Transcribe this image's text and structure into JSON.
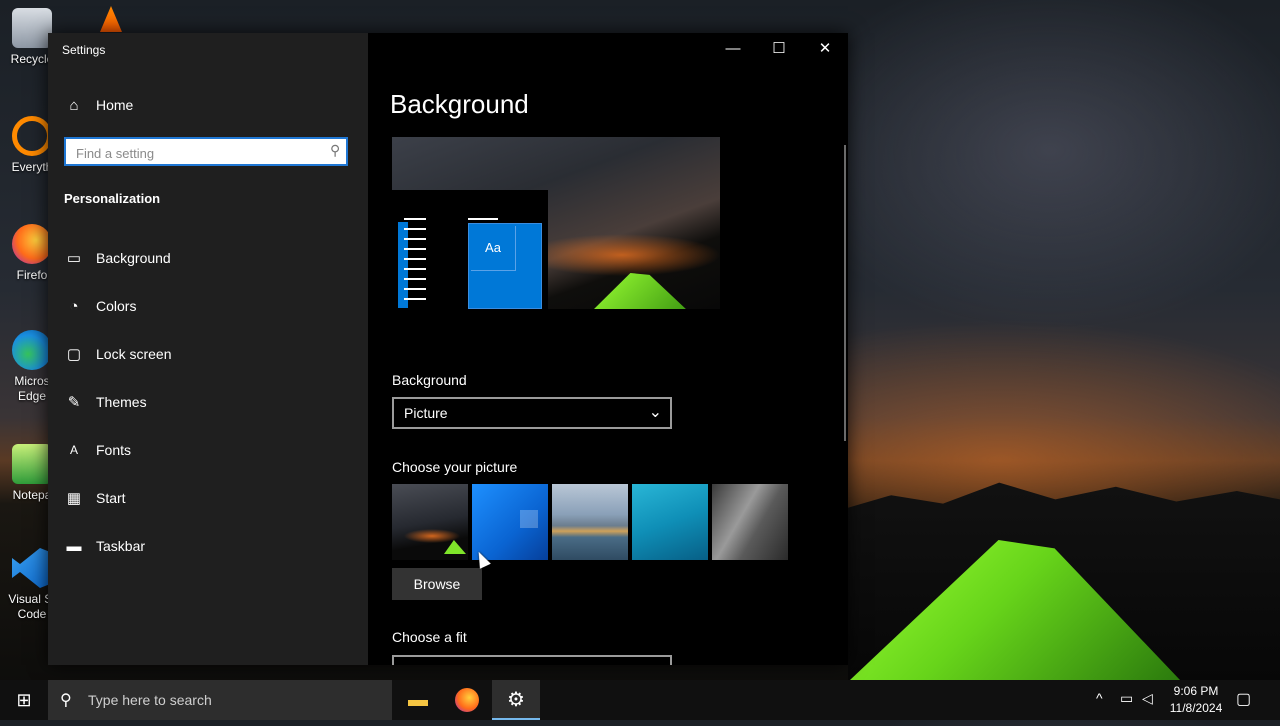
{
  "desktop": {
    "icons": [
      {
        "label": "Recycle",
        "icon": "recycle-bin-icon"
      },
      {
        "label": "Everyth",
        "icon": "everything-icon"
      },
      {
        "label": "Firefo",
        "icon": "firefox-icon"
      },
      {
        "label": "Micros Edge",
        "icon": "edge-icon"
      },
      {
        "label": "Notepa",
        "icon": "notepad-icon"
      },
      {
        "label": "Visual St Code",
        "icon": "vscode-icon"
      }
    ]
  },
  "window": {
    "title": "Settings",
    "minimize": "—",
    "maximize": "☐",
    "close": "✕"
  },
  "sidebar": {
    "home_label": "Home",
    "search_placeholder": "Find a setting",
    "section": "Personalization",
    "items": [
      {
        "label": "Background",
        "icon": "picture-icon"
      },
      {
        "label": "Colors",
        "icon": "palette-icon"
      },
      {
        "label": "Lock screen",
        "icon": "lock-screen-icon"
      },
      {
        "label": "Themes",
        "icon": "themes-icon"
      },
      {
        "label": "Fonts",
        "icon": "fonts-icon"
      },
      {
        "label": "Start",
        "icon": "start-icon"
      },
      {
        "label": "Taskbar",
        "icon": "taskbar-icon"
      }
    ]
  },
  "content": {
    "title": "Background",
    "preview_tile_text": "Aa",
    "background_label": "Background",
    "background_value": "Picture",
    "choose_picture_label": "Choose your picture",
    "browse_label": "Browse",
    "choose_fit_label": "Choose a fit"
  },
  "taskbar": {
    "search_placeholder": "Type here to search",
    "time": "9:06 PM",
    "date": "11/8/2024",
    "apps": [
      "file-explorer-icon",
      "firefox-icon",
      "settings-icon"
    ]
  },
  "colors": {
    "accent": "#0078d7",
    "sidebar_bg": "#1f1f1f",
    "content_bg": "#000000"
  }
}
